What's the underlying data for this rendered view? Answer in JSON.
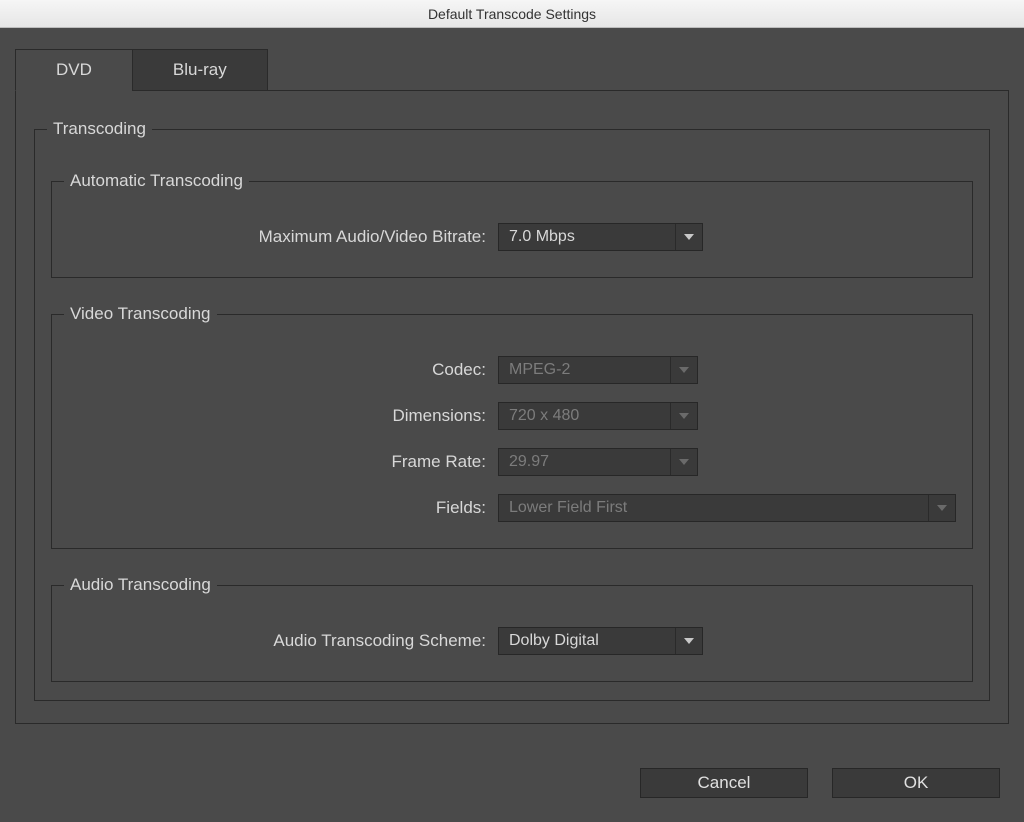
{
  "window": {
    "title": "Default Transcode Settings"
  },
  "tabs": {
    "dvd": "DVD",
    "bluray": "Blu-ray"
  },
  "transcoding": {
    "legend": "Transcoding",
    "automatic": {
      "legend": "Automatic Transcoding",
      "max_bitrate_label": "Maximum Audio/Video Bitrate:",
      "max_bitrate_value": "7.0 Mbps"
    },
    "video": {
      "legend": "Video Transcoding",
      "codec_label": "Codec:",
      "codec_value": "MPEG-2",
      "dimensions_label": "Dimensions:",
      "dimensions_value": "720 x 480",
      "frame_rate_label": "Frame Rate:",
      "frame_rate_value": "29.97",
      "fields_label": "Fields:",
      "fields_value": "Lower Field First"
    },
    "audio": {
      "legend": "Audio Transcoding",
      "scheme_label": "Audio Transcoding Scheme:",
      "scheme_value": "Dolby Digital"
    }
  },
  "buttons": {
    "cancel": "Cancel",
    "ok": "OK"
  }
}
